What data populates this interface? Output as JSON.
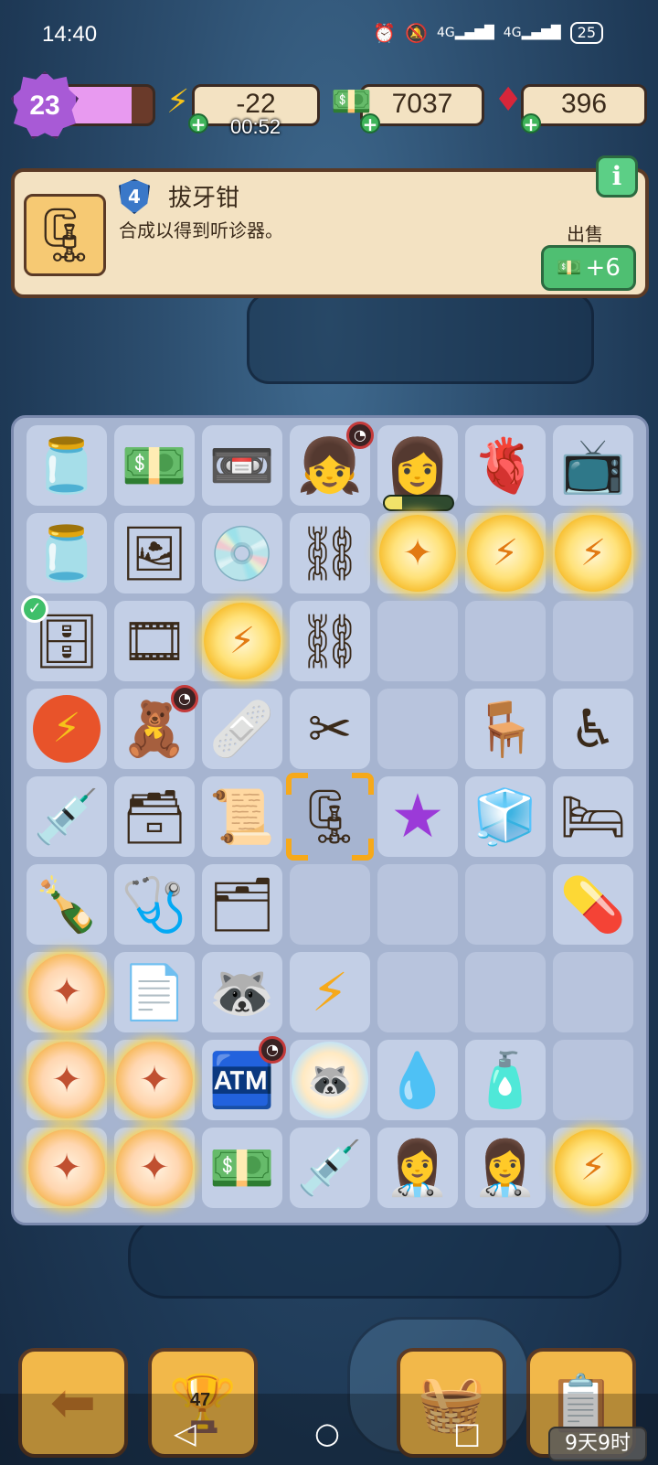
{
  "status_bar": {
    "time": "14:40",
    "icons": [
      "alarm-icon",
      "mute-icon",
      "signal-4g-icon",
      "signal-4g-icon"
    ],
    "signal_label_1": "4G",
    "signal_label_2": "4G",
    "battery": "25"
  },
  "resources": {
    "level": "23",
    "xp_progress": 0.75,
    "energy": "-22",
    "energy_timer": "00:52",
    "cash": "7037",
    "gems": "396"
  },
  "info_panel": {
    "item_level": "4",
    "item_name": "拔牙钳",
    "item_desc": "合成以得到听诊器。",
    "sell_label": "出售",
    "sell_value": "+6",
    "info_button": "i"
  },
  "board": {
    "rows": [
      [
        {
          "item": "jar-with-shell",
          "glyph": "🫙"
        },
        {
          "item": "cash-pile",
          "glyph": "💵"
        },
        {
          "item": "cassette-tape",
          "glyph": "📼"
        },
        {
          "item": "girl-character",
          "glyph": "👧",
          "cooldown": true
        },
        {
          "item": "girl-character-producing",
          "glyph": "👩",
          "progress": 0.25
        },
        {
          "item": "jar-with-heart",
          "glyph": "🫀"
        },
        {
          "item": "retro-tv",
          "glyph": "📺"
        }
      ],
      [
        {
          "item": "jar-with-bear",
          "glyph": "🫙"
        },
        {
          "item": "photographs",
          "glyph": "🖼"
        },
        {
          "item": "cd-disc",
          "glyph": "💿"
        },
        {
          "item": "handcuffs",
          "glyph": "⛓"
        },
        {
          "item": "locked-orb",
          "glyph": "✦",
          "orb": true
        },
        {
          "item": "energy-orb",
          "glyph": "⚡",
          "orb": true
        },
        {
          "item": "energy-orb",
          "glyph": "⚡",
          "orb": true
        }
      ],
      [
        {
          "item": "wooden-cage",
          "glyph": "🗄",
          "checked": true
        },
        {
          "item": "film-strip",
          "glyph": "🎞"
        },
        {
          "item": "energy-orb",
          "glyph": "⚡",
          "orb": true
        },
        {
          "item": "ball-and-chain",
          "glyph": "⛓"
        },
        {
          "item": "",
          "glyph": ""
        },
        {
          "item": "",
          "glyph": ""
        },
        {
          "item": "",
          "glyph": ""
        }
      ],
      [
        {
          "item": "energy-coin",
          "glyph": "⚡"
        },
        {
          "item": "toy-box",
          "glyph": "🧸",
          "cooldown": true
        },
        {
          "item": "bandage-roll",
          "glyph": "🩹"
        },
        {
          "item": "scissors",
          "glyph": "✂"
        },
        {
          "item": "",
          "glyph": ""
        },
        {
          "item": "office-chair",
          "glyph": "🪑"
        },
        {
          "item": "wheelchair",
          "glyph": "♿"
        }
      ],
      [
        {
          "item": "syringe-and-vial",
          "glyph": "💉"
        },
        {
          "item": "wooden-crate",
          "glyph": "🗃"
        },
        {
          "item": "paper-scroll",
          "glyph": "📜"
        },
        {
          "item": "tooth-extraction-forceps",
          "glyph": "🗜",
          "selected": true
        },
        {
          "item": "purple-star",
          "glyph": "★"
        },
        {
          "item": "toy-blocks",
          "glyph": "🧊"
        },
        {
          "item": "hospital-bed",
          "glyph": "🛏"
        }
      ],
      [
        {
          "item": "broken-bottles",
          "glyph": "🍾"
        },
        {
          "item": "stethoscope",
          "glyph": "🩺"
        },
        {
          "item": "reception-desk",
          "glyph": "🗂"
        },
        {
          "item": "",
          "glyph": ""
        },
        {
          "item": "",
          "glyph": ""
        },
        {
          "item": "",
          "glyph": ""
        },
        {
          "item": "pills",
          "glyph": "💊"
        }
      ],
      [
        {
          "item": "locked-orb",
          "glyph": "✦",
          "orb": true,
          "pink": true
        },
        {
          "item": "crumpled-paper",
          "glyph": "📄"
        },
        {
          "item": "raccoon",
          "glyph": "🦝"
        },
        {
          "item": "desk-generator",
          "glyph": "⚡"
        },
        {
          "item": "",
          "glyph": ""
        },
        {
          "item": "",
          "glyph": ""
        },
        {
          "item": "",
          "glyph": ""
        }
      ],
      [
        {
          "item": "locked-orb",
          "glyph": "✦",
          "orb": true,
          "pink": true
        },
        {
          "item": "locked-orb",
          "glyph": "✦",
          "orb": true,
          "pink": true
        },
        {
          "item": "vending-machine",
          "glyph": "🏧",
          "cooldown": true
        },
        {
          "item": "raccoon-bubble",
          "glyph": "🦝",
          "rainbow": true
        },
        {
          "item": "iv-bag",
          "glyph": "💧"
        },
        {
          "item": "medicine-bottle",
          "glyph": "🧴"
        },
        {
          "item": "",
          "glyph": ""
        }
      ],
      [
        {
          "item": "locked-orb",
          "glyph": "✦",
          "orb": true,
          "pink": true
        },
        {
          "item": "locked-orb",
          "glyph": "✦",
          "orb": true,
          "pink": true
        },
        {
          "item": "cash-stack",
          "glyph": "💵"
        },
        {
          "item": "syringe-and-vial",
          "glyph": "💉"
        },
        {
          "item": "nurse-character",
          "glyph": "👩‍⚕"
        },
        {
          "item": "nurse-character",
          "glyph": "👩‍⚕"
        },
        {
          "item": "energy-orb",
          "glyph": "⚡",
          "orb": true
        }
      ]
    ]
  },
  "bottom_nav": {
    "back_icon": "arrow-left-icon",
    "trophy_count": "47",
    "basket_icon": "basket-icon",
    "tasks_icon": "clipboard-star-icon",
    "event_timer": "9天9时"
  },
  "colors": {
    "panel": "#f3e2c2",
    "board": "#a6b4d0",
    "accent_green": "#4fbf72",
    "selection": "#f6a91a"
  }
}
